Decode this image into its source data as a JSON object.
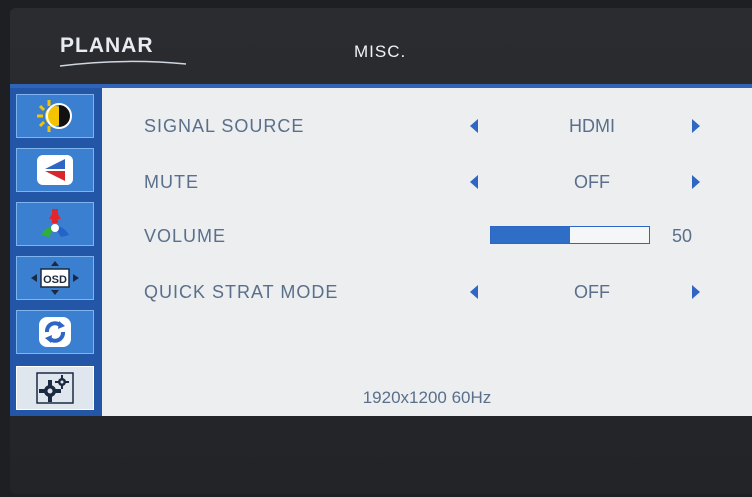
{
  "header": {
    "brand": "PLANAR",
    "menu_title": "MISC."
  },
  "sidebar": {
    "tabs": [
      {
        "icon": "brightness-contrast-icon"
      },
      {
        "icon": "input-source-icon"
      },
      {
        "icon": "color-icon"
      },
      {
        "icon": "osd-settings-icon"
      },
      {
        "icon": "reset-icon"
      },
      {
        "icon": "misc-settings-icon",
        "selected": true
      }
    ]
  },
  "settings": [
    {
      "label": "SIGNAL SOURCE",
      "value": "HDMI"
    },
    {
      "label": "MUTE",
      "value": "OFF"
    },
    {
      "label": "VOLUME",
      "value": "50",
      "level": 0.5
    },
    {
      "label": "QUICK STRAT MODE",
      "value": "OFF"
    }
  ],
  "status": {
    "resolution": "1920x1200 60Hz"
  },
  "colors": {
    "accent": "#2f66c4",
    "panel": "#eceef0",
    "text": "#5a6f8a"
  }
}
